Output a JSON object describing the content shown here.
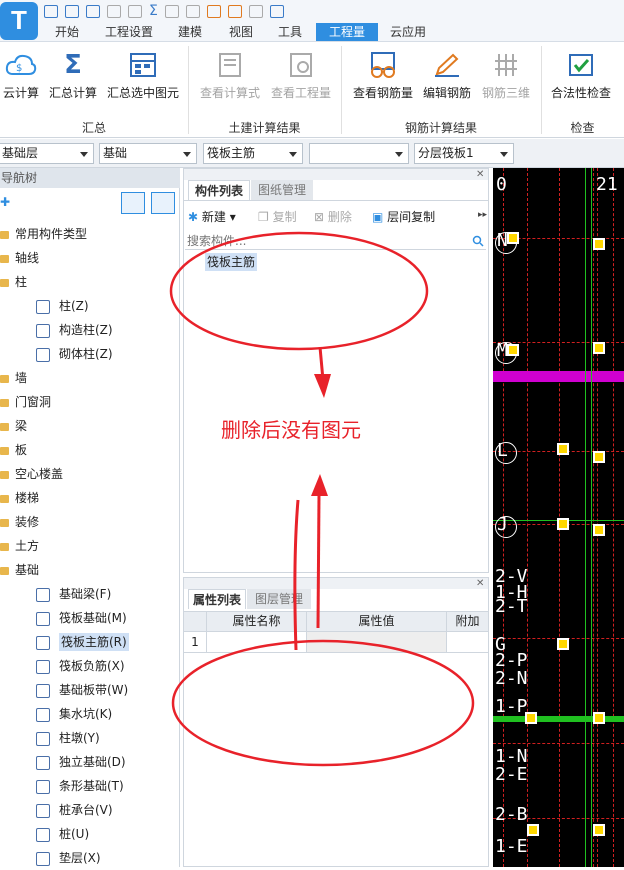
{
  "app": {
    "logo": "T"
  },
  "menu": {
    "tabs": [
      "开始",
      "工程设置",
      "建模",
      "视图",
      "工具",
      "工程量",
      "云应用"
    ],
    "active": "工程量"
  },
  "ribbon": {
    "buttons": [
      "云计算",
      "汇总计算",
      "汇总选中图元",
      "查看计算式",
      "查看工程量",
      "查看钢筋量",
      "编辑钢筋",
      "钢筋三维",
      "合法性检查"
    ],
    "groups": [
      "汇总",
      "土建计算结果",
      "钢筋计算结果",
      "检查"
    ]
  },
  "selectors": {
    "floor": "基础层",
    "category": "基础",
    "type": "筏板主筋",
    "blank": "",
    "layer": "分层筏板1"
  },
  "nav": {
    "title": "导航树",
    "items": [
      {
        "label": "常用构件类型",
        "level": 0
      },
      {
        "label": "轴线",
        "level": 0
      },
      {
        "label": "柱",
        "level": 0
      },
      {
        "label": "柱(Z)",
        "level": 1
      },
      {
        "label": "构造柱(Z)",
        "level": 1
      },
      {
        "label": "砌体柱(Z)",
        "level": 1
      },
      {
        "label": "墙",
        "level": 0
      },
      {
        "label": "门窗洞",
        "level": 0
      },
      {
        "label": "梁",
        "level": 0
      },
      {
        "label": "板",
        "level": 0
      },
      {
        "label": "空心楼盖",
        "level": 0
      },
      {
        "label": "楼梯",
        "level": 0
      },
      {
        "label": "装修",
        "level": 0
      },
      {
        "label": "土方",
        "level": 0
      },
      {
        "label": "基础",
        "level": 0
      },
      {
        "label": "基础梁(F)",
        "level": 1
      },
      {
        "label": "筏板基础(M)",
        "level": 1
      },
      {
        "label": "筏板主筋(R)",
        "level": 1
      },
      {
        "label": "筏板负筋(X)",
        "level": 1
      },
      {
        "label": "基础板带(W)",
        "level": 1
      },
      {
        "label": "集水坑(K)",
        "level": 1
      },
      {
        "label": "柱墩(Y)",
        "level": 1
      },
      {
        "label": "独立基础(D)",
        "level": 1
      },
      {
        "label": "条形基础(T)",
        "level": 1
      },
      {
        "label": "桩承台(V)",
        "level": 1
      },
      {
        "label": "桩(U)",
        "level": 1
      },
      {
        "label": "垫层(X)",
        "level": 1
      }
    ],
    "selected": "筏板主筋(R)"
  },
  "component_panel": {
    "tabs": [
      "构件列表",
      "图纸管理"
    ],
    "toolbar": {
      "new": "新建",
      "copy": "复制",
      "delete": "删除",
      "floor_copy": "层间复制"
    },
    "search_placeholder": "搜索构件...",
    "items": [
      "筏板主筋"
    ]
  },
  "property_panel": {
    "tabs": [
      "属性列表",
      "图层管理"
    ],
    "columns": [
      "属性名称",
      "属性值",
      "附加"
    ],
    "rows": [
      {
        "index": "1",
        "name": "",
        "value": ""
      }
    ]
  },
  "annotation": {
    "text": "删除后没有图元",
    "color": "#e8222a"
  },
  "cad": {
    "labels": [
      "0",
      "21",
      "N",
      "M",
      "L",
      "J",
      "2-V",
      "1-H",
      "2-T",
      "G",
      "2-P",
      "2-N",
      "1-P",
      "1-N",
      "2-E",
      "2-B",
      "1-E"
    ]
  },
  "colors": {
    "accent": "#2f8ee0",
    "cad_bg": "#000000",
    "cad_grid": "#d02020",
    "cad_green": "#20c020",
    "cad_magenta": "#d000d0",
    "col_fill": "#ffd700"
  }
}
